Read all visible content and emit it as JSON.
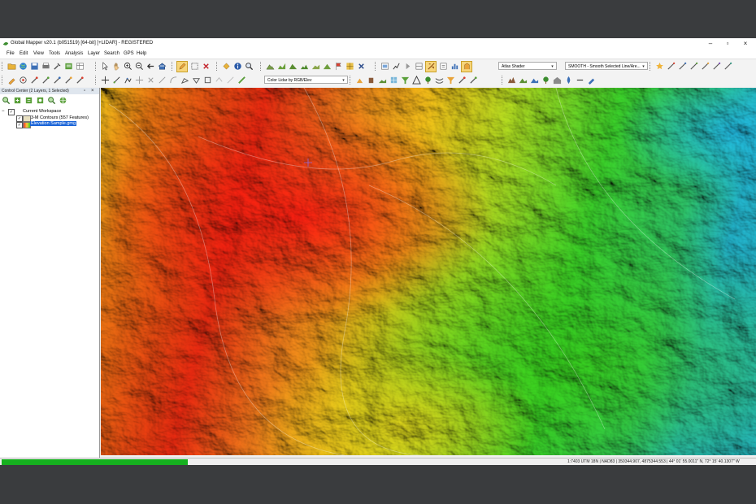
{
  "window": {
    "title": "Global Mapper v20.1 (b051519) [64-bit] [+LIDAR] - REGISTERED",
    "min_label": "–",
    "max_label": "▫",
    "close_label": "×"
  },
  "menu": [
    "File",
    "Edit",
    "View",
    "Tools",
    "Analysis",
    "Layer",
    "Search",
    "GPS",
    "Help"
  ],
  "toolbar": {
    "shader_select": "Atlas Shader",
    "smooth_select": "SMOOTH - Smooth Selected Line/Are...",
    "lidar_color_select": "Color Lidar by RGB/Elev"
  },
  "control_center": {
    "title": "Control Center (2 Layers, 1 Selected)",
    "workspace_label": "Current Workspace",
    "layers": [
      {
        "name": "3-M Contours (557 Features)",
        "checked": true,
        "selected": false
      },
      {
        "name": "Elevation Sample.gmg",
        "checked": true,
        "selected": true
      }
    ]
  },
  "status": {
    "progress": 0.25,
    "text": "1:7403   UTM 18N | NAD83 | 350344.907, 4875344.553 | 44° 01' 55.0011\" N, 72° 15' 40.1307\" W"
  },
  "colors": {
    "titlebar": "#ffffff",
    "progress": "#16b01f",
    "selection": "#1a64d8",
    "background": "#3a3c3e"
  }
}
